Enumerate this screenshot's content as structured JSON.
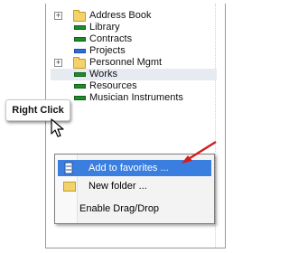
{
  "tree": {
    "items": [
      {
        "label": "Address Book",
        "icon": "folder-icon",
        "expandable": true
      },
      {
        "label": "Library",
        "icon": "green-bar-icon",
        "expandable": false
      },
      {
        "label": "Contracts",
        "icon": "green-bar-icon",
        "expandable": false
      },
      {
        "label": "Projects",
        "icon": "blue-bar-icon",
        "expandable": false
      },
      {
        "label": "Personnel Mgmt",
        "icon": "folder-icon",
        "expandable": true
      },
      {
        "label": "Works",
        "icon": "green-bar-icon",
        "expandable": false,
        "selected": true
      },
      {
        "label": "Resources",
        "icon": "green-bar-icon",
        "expandable": false
      },
      {
        "label": "Musician Instruments",
        "icon": "green-bar-icon",
        "expandable": false
      }
    ],
    "expander_symbol": "+"
  },
  "callout": {
    "label": "Right Click"
  },
  "context_menu": {
    "items": [
      {
        "label": "Add to favorites ...",
        "highlighted": true,
        "icon": "favorites-icon"
      },
      {
        "label": "New folder ...",
        "highlighted": false,
        "icon": "folder-icon"
      },
      {
        "label": "Enable Drag/Drop",
        "highlighted": false,
        "icon": ""
      }
    ]
  },
  "colors": {
    "green_bar": "#1e8a2a",
    "blue_bar": "#2d6fd8",
    "menu_highlight": "#3a7ee0",
    "arrow_red": "#d21e1e",
    "folder_yellow": "#f2d36a"
  }
}
